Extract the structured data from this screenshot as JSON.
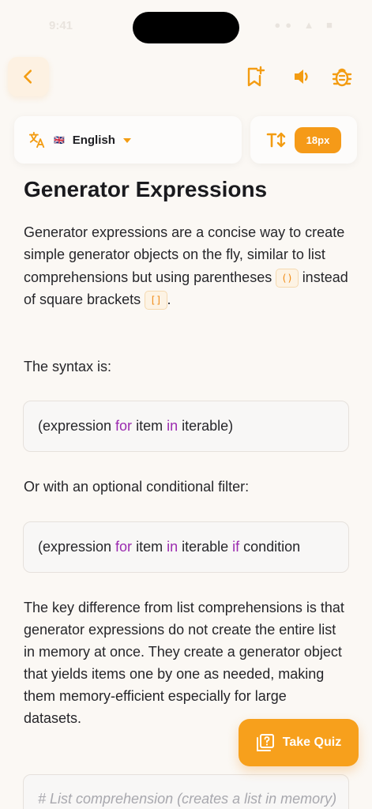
{
  "status": {
    "time": "9:41",
    "indicators": "●● ▲ ■"
  },
  "toolbar": {
    "back_icon": "chevron-left-icon",
    "bookmark_icon": "bookmark-add-icon",
    "sound_icon": "speaker-icon",
    "bug_icon": "bug-icon",
    "accent": "#f59a18"
  },
  "language": {
    "flag": "🇬🇧",
    "name": "English"
  },
  "font_size": {
    "label": "18px"
  },
  "article": {
    "title": "Generator Expressions",
    "intro_part1": "Generator expressions are a concise way to create simple generator objects on the fly, similar to list comprehensions but using parentheses",
    "intro_code1": "()",
    "intro_part2": "instead of square brackets",
    "intro_code2": "[]",
    "intro_part3": ".",
    "syntax_label": "The syntax is:",
    "code1": {
      "p1": "(expression ",
      "kw1": "for",
      "p2": " item ",
      "kw2": "in",
      "p3": " iterable)"
    },
    "filter_label": "Or with an optional conditional filter:",
    "code2": {
      "p1": "(expression ",
      "kw1": "for",
      "p2": " item ",
      "kw2": "in",
      "p3": " iterable ",
      "kw3": "if",
      "p4": " condition"
    },
    "difference": "The key difference from list comprehensions is that generator expressions do not create the entire list in memory at once. They create a generator object that yields items one by one as needed, making them memory-efficient especially for large datasets.",
    "bottom_comment": "# List comprehension (creates a list in memory)"
  },
  "quiz": {
    "label": "Take Quiz"
  }
}
